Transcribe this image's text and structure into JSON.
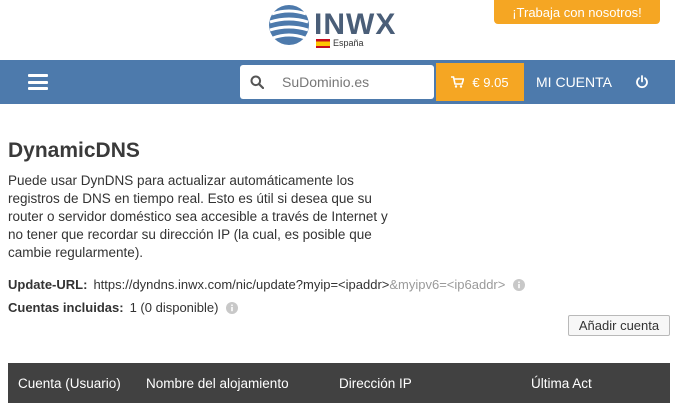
{
  "brand": {
    "name": "INWX",
    "country": "España"
  },
  "header": {
    "jobs_label": "¡Trabaja con nosotros!"
  },
  "nav": {
    "search_placeholder": "SuDominio.es",
    "cart_amount": "€ 9.05",
    "account_label": "MI CUENTA"
  },
  "main": {
    "title": "DynamicDNS",
    "description": "Puede usar DynDNS para actualizar automáticamente los registros de DNS en tiempo real. Esto es útil si desea que su router o servidor doméstico sea accesible a través de Internet y no tener que recordar su dirección IP (la cual, es posible que cambie regularmente).",
    "update_url_label": "Update-URL:",
    "update_url_value": "https://dyndns.inwx.com/nic/update?myip=<ipaddr>",
    "update_url_extra": "&myipv6=<ip6addr>",
    "accounts_label": "Cuentas incluidas:",
    "accounts_value": "1  (0 disponible)",
    "add_account_label": "Añadir cuenta"
  },
  "table": {
    "columns": [
      "Cuenta (Usuario)",
      "Nombre del alojamiento",
      "Dirección IP",
      "Última Act"
    ]
  },
  "colors": {
    "nav_blue": "#4d7aac",
    "accent_orange": "#f5a623",
    "table_header": "#414141"
  }
}
